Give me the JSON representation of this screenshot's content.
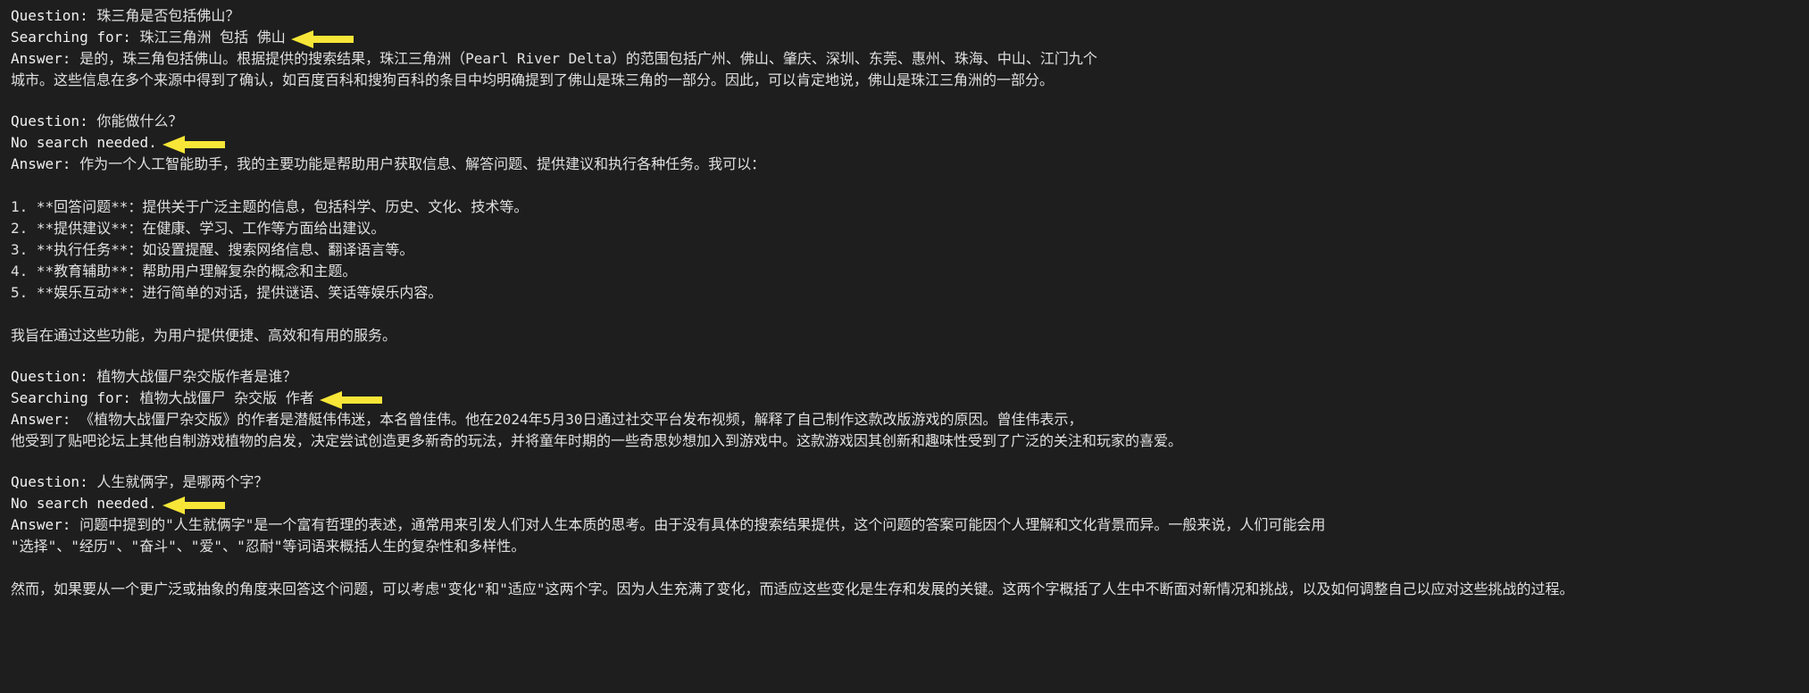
{
  "labels": {
    "question": "Question: ",
    "searching": "Searching for: ",
    "nosearch": "No search needed.",
    "answer": "Answer: "
  },
  "qa": [
    {
      "question": "珠三角是否包括佛山？",
      "search_needed": true,
      "search_query": "珠江三角洲 包括 佛山",
      "has_arrow": true,
      "answer_inline": "是的，珠三角包括佛山。根据提供的搜索结果，珠江三角洲（Pearl River Delta）的范围包括广州、佛山、肇庆、深圳、东莞、惠州、珠海、中山、江门九个",
      "answer_body": "城市。这些信息在多个来源中得到了确认，如百度百科和搜狗百科的条目中均明确提到了佛山是珠三角的一部分。因此，可以肯定地说，佛山是珠江三角洲的一部分。"
    },
    {
      "question": "你能做什么？",
      "search_needed": false,
      "search_query": "",
      "has_arrow": true,
      "answer_inline": "作为一个人工智能助手，我的主要功能是帮助用户获取信息、解答问题、提供建议和执行各种任务。我可以：",
      "answer_body": "\n1. **回答问题**：提供关于广泛主题的信息，包括科学、历史、文化、技术等。\n2. **提供建议**：在健康、学习、工作等方面给出建议。\n3. **执行任务**：如设置提醒、搜索网络信息、翻译语言等。\n4. **教育辅助**：帮助用户理解复杂的概念和主题。\n5. **娱乐互动**：进行简单的对话，提供谜语、笑话等娱乐内容。\n\n我旨在通过这些功能，为用户提供便捷、高效和有用的服务。"
    },
    {
      "question": "植物大战僵尸杂交版作者是谁？",
      "search_needed": true,
      "search_query": "植物大战僵尸 杂交版 作者",
      "has_arrow": true,
      "answer_inline": "《植物大战僵尸杂交版》的作者是潜艇伟伟迷，本名曾佳伟。他在2024年5月30日通过社交平台发布视频，解释了自己制作这款改版游戏的原因。曾佳伟表示，",
      "answer_body": "他受到了贴吧论坛上其他自制游戏植物的启发，决定尝试创造更多新奇的玩法，并将童年时期的一些奇思妙想加入到游戏中。这款游戏因其创新和趣味性受到了广泛的关注和玩家的喜爱。"
    },
    {
      "question": "人生就俩字，是哪两个字？",
      "search_needed": false,
      "search_query": "",
      "has_arrow": true,
      "answer_inline": "问题中提到的\"人生就俩字\"是一个富有哲理的表述，通常用来引发人们对人生本质的思考。由于没有具体的搜索结果提供，这个问题的答案可能因个人理解和文化背景而异。一般来说，人们可能会用",
      "answer_body": "\"选择\"、\"经历\"、\"奋斗\"、\"爱\"、\"忍耐\"等词语来概括人生的复杂性和多样性。\n\n然而，如果要从一个更广泛或抽象的角度来回答这个问题，可以考虑\"变化\"和\"适应\"这两个字。因为人生充满了变化，而适应这些变化是生存和发展的关键。这两个字概括了人生中不断面对新情况和挑战，以及如何调整自己以应对这些挑战的过程。"
    }
  ]
}
